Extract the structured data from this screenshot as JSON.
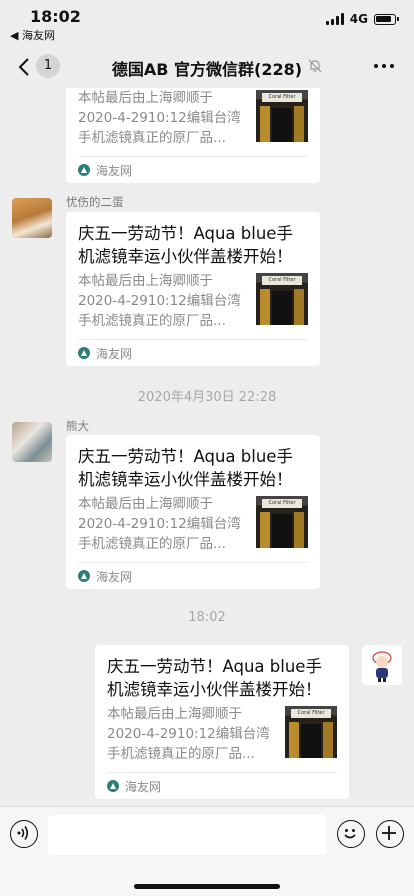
{
  "status": {
    "time": "18:02",
    "back_app": "◀ 海友网",
    "network": "4G"
  },
  "nav": {
    "back_count": "1",
    "title": "德国AB  官方微信群(228)"
  },
  "shared_card": {
    "title": "庆五一劳动节！Aqua blue手机滤镜幸运小伙伴盖楼开始！",
    "desc": "本帖最后由上海卿顺于2020-4-2910:12编辑台湾手机滤镜真正的原厂品...",
    "thumb_label": "Coral Filter",
    "source": "海友网"
  },
  "messages": [
    {
      "sender": "",
      "partial": true
    },
    {
      "sender": "忧伤的二蛋"
    },
    {
      "timestamp": "2020年4月30日 22:28"
    },
    {
      "sender": "熊大"
    },
    {
      "timestamp": "18:02"
    },
    {
      "sender": "",
      "self": true
    }
  ],
  "input": {
    "voice_icon": "voice-icon",
    "emoji_icon": "emoji-icon",
    "plus_icon": "plus-icon"
  }
}
